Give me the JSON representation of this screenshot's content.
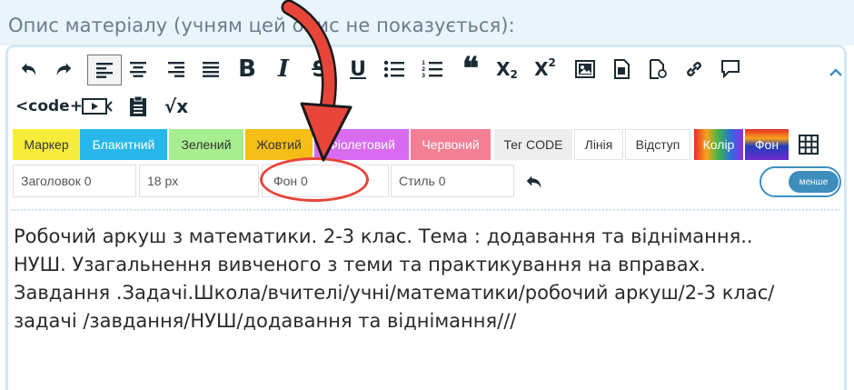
{
  "description_label": "Опис матеріалу (учням цей опис не показується):",
  "toolbar": {
    "row1": [
      {
        "name": "undo-icon",
        "glyph": "↶"
      },
      {
        "name": "redo-icon",
        "glyph": "↷"
      },
      {
        "name": "align-left-icon",
        "glyph": "align-left"
      },
      {
        "name": "align-center-icon",
        "glyph": "align-center"
      },
      {
        "name": "align-right-icon",
        "glyph": "align-right"
      },
      {
        "name": "align-justify-icon",
        "glyph": "align-justify"
      },
      {
        "name": "bold-icon",
        "glyph": "B"
      },
      {
        "name": "italic-icon",
        "glyph": "I"
      },
      {
        "name": "strikethrough-icon",
        "glyph": "S"
      },
      {
        "name": "underline-icon",
        "glyph": "U"
      },
      {
        "name": "bullet-list-icon",
        "glyph": "ul"
      },
      {
        "name": "numbered-list-icon",
        "glyph": "ol"
      },
      {
        "name": "quote-icon",
        "glyph": "66"
      },
      {
        "name": "subscript-icon",
        "glyph": "X₂"
      },
      {
        "name": "superscript-icon",
        "glyph": "X²"
      },
      {
        "name": "image-icon",
        "glyph": "img"
      },
      {
        "name": "file-icon",
        "glyph": "file"
      },
      {
        "name": "file-add-icon",
        "glyph": "file-add"
      },
      {
        "name": "link-icon",
        "glyph": "link"
      },
      {
        "name": "comment-icon",
        "glyph": "comment"
      }
    ],
    "row2": [
      {
        "name": "code-icon",
        "glyph": "<code+"
      },
      {
        "name": "video-icon",
        "glyph": "video"
      },
      {
        "name": "clipboard-icon",
        "glyph": "clipboard"
      },
      {
        "name": "sqrt-icon",
        "glyph": "√x"
      }
    ]
  },
  "colors": [
    {
      "label": "Маркер",
      "bg": "#f7ec3a",
      "fg": "#333333"
    },
    {
      "label": "Блакитний",
      "bg": "#27b7ea",
      "fg": "#ffffff"
    },
    {
      "label": "Зелений",
      "bg": "#a6ee8f",
      "fg": "#333333"
    },
    {
      "label": "Жовтий",
      "bg": "#f6bd16",
      "fg": "#333333"
    },
    {
      "label": "Фіолетовий",
      "bg": "#d96bf1",
      "fg": "#ffffff"
    },
    {
      "label": "Червоний",
      "bg": "#f37f94",
      "fg": "#ffffff"
    },
    {
      "label": "Тег CODE",
      "bg": "#eeeeee",
      "fg": "#333333"
    },
    {
      "label": "Лінія",
      "bg": "#ffffff",
      "fg": "#333333"
    },
    {
      "label": "Відступ",
      "bg": "#ffffff",
      "fg": "#333333"
    },
    {
      "label": "Колір",
      "bg": "rainbow",
      "fg": "#ffffff"
    },
    {
      "label": "Фон",
      "bg": "rainbow2",
      "fg": "#ffffff"
    }
  ],
  "fields": {
    "heading": "Заголовок 0",
    "size": "18 px",
    "background": "Фон 0",
    "style": "Стиль 0"
  },
  "toggle_label": "менше",
  "content": {
    "lines": [
      "Робочий аркуш з математики. 2-3 клас. Тема : додавання та віднімання..",
      "НУШ. Узагальнення вивченого з теми та практикування на вправах.",
      "Завдання .Задачі.Школа/вчителі/учні/математики/робочий аркуш/2-3 клас/",
      "задачі /завдання/НУШ/додавання та віднімання///"
    ]
  },
  "annotation_color": "#e7453a"
}
